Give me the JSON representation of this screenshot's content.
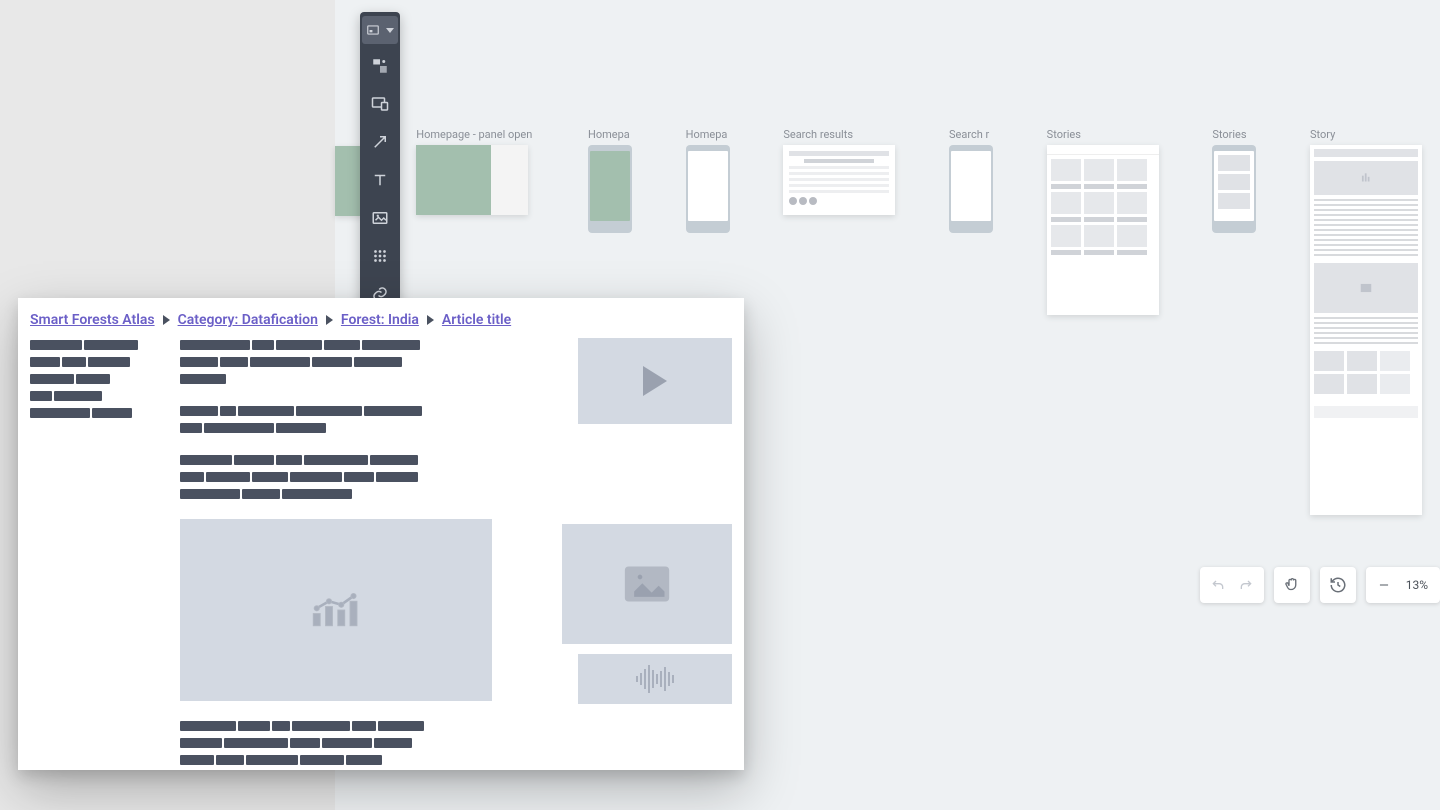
{
  "frames": {
    "homepage_open": "Homepage - panel open",
    "homepage_m1": "Homepa",
    "homepage_m2": "Homepa",
    "search_results": "Search results",
    "search_m": "Search r",
    "stories": "Stories",
    "stories_m": "Stories",
    "story": "Story"
  },
  "zoom": {
    "level": "13%"
  },
  "preview": {
    "crumbs": {
      "root": "Smart Forests Atlas",
      "category": "Category: Datafication",
      "forest": "Forest: India",
      "article": "Article title"
    }
  }
}
